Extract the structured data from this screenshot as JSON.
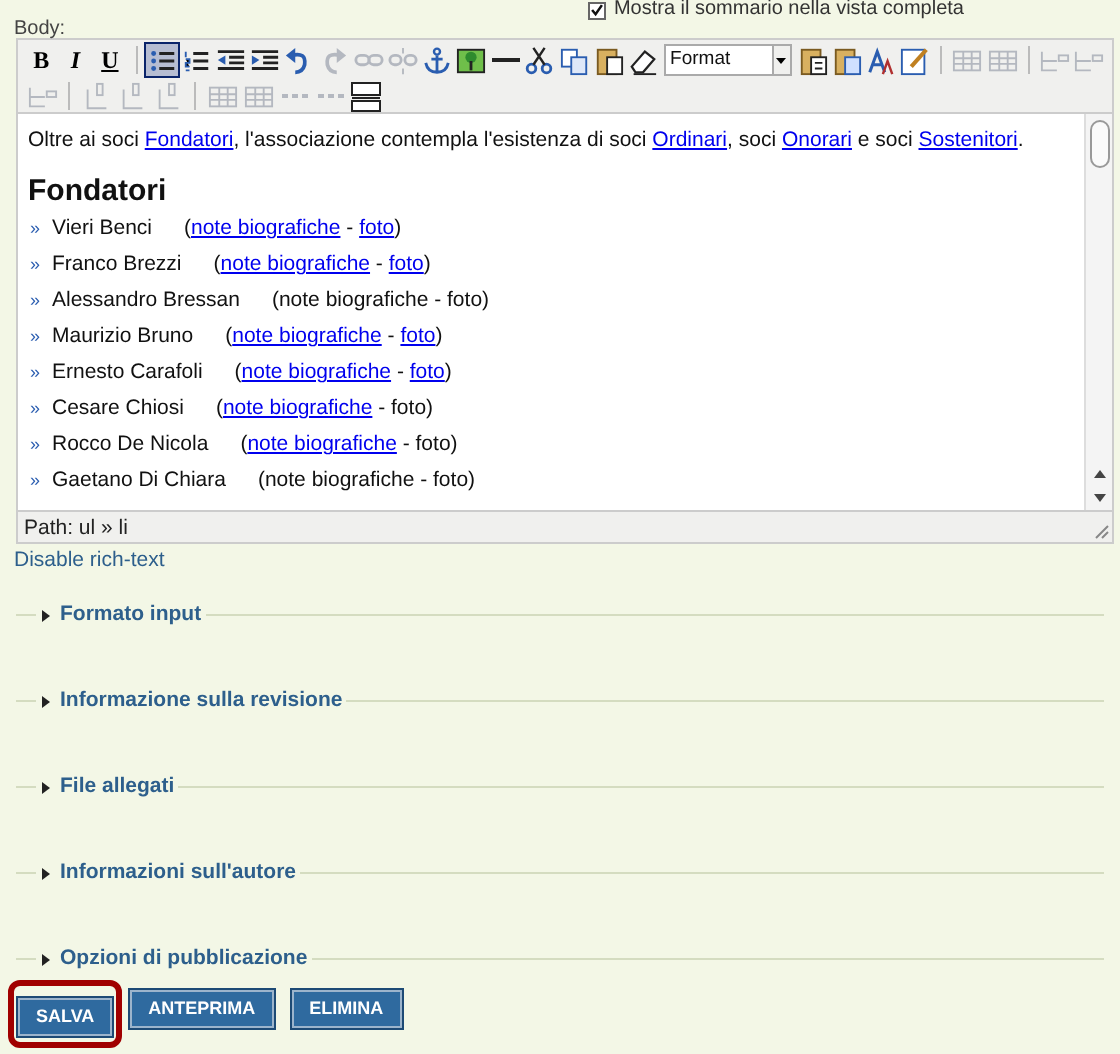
{
  "summary_option": {
    "label": "Mostra il sommario nella vista completa",
    "checked": true
  },
  "body_label": "Body:",
  "toolbar_rows": [
    [
      {
        "kind": "bold",
        "text": "B",
        "selected": false,
        "disabled": false
      },
      {
        "kind": "italic",
        "text": "I",
        "selected": false,
        "disabled": false
      },
      {
        "kind": "underline",
        "text": "U",
        "selected": false,
        "disabled": false
      },
      {
        "kind": "separator"
      },
      {
        "kind": "bullist",
        "selected": true,
        "disabled": false
      },
      {
        "kind": "numlist",
        "selected": false,
        "disabled": false
      },
      {
        "kind": "outdent",
        "selected": false,
        "disabled": false
      },
      {
        "kind": "indent",
        "selected": false,
        "disabled": false
      },
      {
        "kind": "undo",
        "selected": false,
        "disabled": false
      },
      {
        "kind": "redo",
        "selected": false,
        "disabled": true
      },
      {
        "kind": "link",
        "selected": false,
        "disabled": true
      },
      {
        "kind": "unlink",
        "selected": false,
        "disabled": true
      },
      {
        "kind": "anchor",
        "selected": false,
        "disabled": false
      },
      {
        "kind": "image",
        "selected": false,
        "disabled": false
      },
      {
        "kind": "hr",
        "selected": false,
        "disabled": false
      },
      {
        "kind": "cut",
        "selected": false,
        "disabled": false
      },
      {
        "kind": "copy",
        "selected": false,
        "disabled": false
      },
      {
        "kind": "paste",
        "selected": false,
        "disabled": false
      },
      {
        "kind": "eraser",
        "selected": false,
        "disabled": false
      },
      {
        "kind": "select",
        "text": "Format"
      },
      {
        "kind": "pastetext",
        "selected": false,
        "disabled": false
      },
      {
        "kind": "pasteword",
        "selected": false,
        "disabled": false
      },
      {
        "kind": "style",
        "selected": false,
        "disabled": false
      },
      {
        "kind": "edit",
        "selected": false,
        "disabled": false
      },
      {
        "kind": "separator"
      },
      {
        "kind": "table",
        "selected": false,
        "disabled": true
      },
      {
        "kind": "table",
        "selected": false,
        "disabled": true
      },
      {
        "kind": "separator"
      },
      {
        "kind": "row",
        "selected": false,
        "disabled": true
      },
      {
        "kind": "row",
        "selected": false,
        "disabled": true
      }
    ],
    [
      {
        "kind": "row",
        "selected": false,
        "disabled": true
      },
      {
        "kind": "separator"
      },
      {
        "kind": "col",
        "selected": false,
        "disabled": true
      },
      {
        "kind": "col",
        "selected": false,
        "disabled": true
      },
      {
        "kind": "col",
        "selected": false,
        "disabled": true
      },
      {
        "kind": "separator"
      },
      {
        "kind": "table",
        "selected": false,
        "disabled": true
      },
      {
        "kind": "table",
        "selected": false,
        "disabled": true
      },
      {
        "kind": "abbr",
        "selected": false,
        "disabled": true
      },
      {
        "kind": "abbr",
        "selected": false,
        "disabled": true
      },
      {
        "kind": "split",
        "selected": false,
        "disabled": false
      }
    ]
  ],
  "intro": [
    {
      "text": "Oltre ai soci ",
      "kind": "text"
    },
    {
      "text": "Fondatori",
      "kind": "link"
    },
    {
      "text": ", l'associazione contempla l'esistenza di soci ",
      "kind": "text"
    },
    {
      "text": "Ordinari",
      "kind": "link"
    },
    {
      "text": ", soci ",
      "kind": "text"
    },
    {
      "text": "Onorari",
      "kind": "link"
    },
    {
      "text": " e soci ",
      "kind": "text"
    },
    {
      "text": "Sostenitori",
      "kind": "link"
    },
    {
      "text": ".",
      "kind": "text"
    }
  ],
  "heading": "Fondatori",
  "members": [
    {
      "marker": "»",
      "name": "Vieri Benci",
      "parts": [
        {
          "text": "(",
          "kind": "text"
        },
        {
          "text": "note biografiche",
          "kind": "link"
        },
        {
          "text": " - ",
          "kind": "text"
        },
        {
          "text": "foto",
          "kind": "link"
        },
        {
          "text": ")",
          "kind": "text"
        }
      ]
    },
    {
      "marker": "»",
      "name": "Franco Brezzi",
      "parts": [
        {
          "text": "(",
          "kind": "text"
        },
        {
          "text": "note biografiche",
          "kind": "link"
        },
        {
          "text": " - ",
          "kind": "text"
        },
        {
          "text": "foto",
          "kind": "link"
        },
        {
          "text": ")",
          "kind": "text"
        }
      ]
    },
    {
      "marker": "»",
      "name": "Alessandro Bressan",
      "parts": [
        {
          "text": "(note biografiche - foto)",
          "kind": "text"
        }
      ]
    },
    {
      "marker": "»",
      "name": "Maurizio Bruno",
      "parts": [
        {
          "text": "(",
          "kind": "text"
        },
        {
          "text": "note biografiche",
          "kind": "link"
        },
        {
          "text": " - ",
          "kind": "text"
        },
        {
          "text": "foto",
          "kind": "link"
        },
        {
          "text": ")",
          "kind": "text"
        }
      ]
    },
    {
      "marker": "»",
      "name": "Ernesto Carafoli",
      "parts": [
        {
          "text": "(",
          "kind": "text"
        },
        {
          "text": "note biografiche",
          "kind": "link"
        },
        {
          "text": " - ",
          "kind": "text"
        },
        {
          "text": "foto",
          "kind": "link"
        },
        {
          "text": ")",
          "kind": "text"
        }
      ]
    },
    {
      "marker": "»",
      "name": "Cesare Chiosi",
      "parts": [
        {
          "text": "(",
          "kind": "text"
        },
        {
          "text": "note biografiche",
          "kind": "link"
        },
        {
          "text": " - foto)",
          "kind": "text"
        }
      ]
    },
    {
      "marker": "»",
      "name": "Rocco De Nicola",
      "parts": [
        {
          "text": "(",
          "kind": "text"
        },
        {
          "text": "note biografiche",
          "kind": "link"
        },
        {
          "text": " - foto)",
          "kind": "text"
        }
      ]
    },
    {
      "marker": "»",
      "name": "Gaetano Di Chiara",
      "parts": [
        {
          "text": "(note biografiche - foto)",
          "kind": "text"
        }
      ]
    }
  ],
  "path": "Path: ul » li",
  "disable_link": "Disable rich-text",
  "sections": [
    {
      "title": "Formato input",
      "expanded": false
    },
    {
      "title": "Informazione sulla revisione",
      "expanded": false
    },
    {
      "title": "File allegati",
      "expanded": false
    },
    {
      "title": "Informazioni sull'autore",
      "expanded": false
    },
    {
      "title": "Opzioni di pubblicazione",
      "expanded": false
    }
  ],
  "buttons": [
    {
      "label": "SALVA",
      "highlighted": true
    },
    {
      "label": "ANTEPRIMA",
      "highlighted": false
    },
    {
      "label": "ELIMINA",
      "highlighted": false
    }
  ]
}
